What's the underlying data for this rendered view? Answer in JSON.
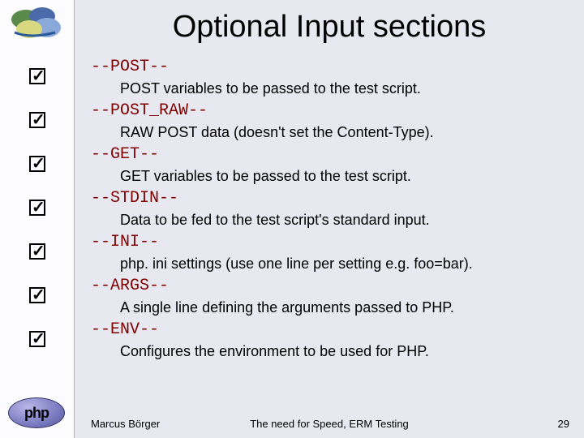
{
  "title": "Optional Input sections",
  "sections": [
    {
      "header": "--POST--",
      "body": "POST variables to be passed to the test script."
    },
    {
      "header": "--POST_RAW--",
      "body": "RAW POST data (doesn't set the Content-Type)."
    },
    {
      "header": "--GET--",
      "body": "GET variables to be passed to the test script."
    },
    {
      "header": "--STDIN--",
      "body": "Data to be fed to the test script's standard input."
    },
    {
      "header": "--INI--",
      "body": "php. ini settings (use one line per setting e.g. foo=bar)."
    },
    {
      "header": "--ARGS--",
      "body": "A single line defining the arguments passed to PHP."
    },
    {
      "header": "--ENV--",
      "body": "Configures the environment to be used for PHP."
    }
  ],
  "php_logo_text": "php",
  "footer": {
    "author": "Marcus Börger",
    "title": "The need for Speed, ERM Testing",
    "page_number": "29"
  }
}
